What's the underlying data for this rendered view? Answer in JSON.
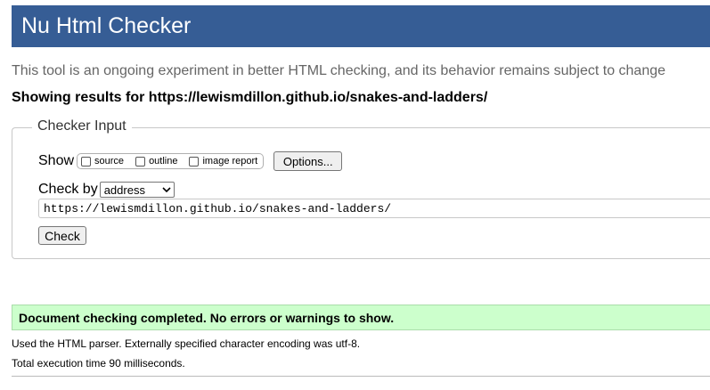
{
  "header": {
    "title": "Nu Html Checker"
  },
  "tagline": "This tool is an ongoing experiment in better HTML checking, and its behavior remains subject to change",
  "showing_results": "Showing results for https://lewismdillon.github.io/snakes-and-ladders/",
  "checker_input": {
    "legend": "Checker Input",
    "show_label": "Show",
    "show_options": [
      {
        "label": "source",
        "checked": false
      },
      {
        "label": "outline",
        "checked": false
      },
      {
        "label": "image report",
        "checked": false
      }
    ],
    "options_button": "Options...",
    "check_by_label": "Check by",
    "check_by_value": "address",
    "url_value": "https://lewismdillon.github.io/snakes-and-ladders/",
    "check_button": "Check"
  },
  "result": {
    "message": "Document checking completed. No errors or warnings to show.",
    "background_color": "#ccffcc"
  },
  "parser_note": "Used the HTML parser. Externally specified character encoding was utf-8.",
  "execution_time": "Total execution time 90 milliseconds.",
  "colors": {
    "header_background": "#365d95",
    "header_text": "#ffffff",
    "tagline_text": "#666666"
  },
  "icons": {
    "select_arrow": "chevron-down-icon"
  }
}
